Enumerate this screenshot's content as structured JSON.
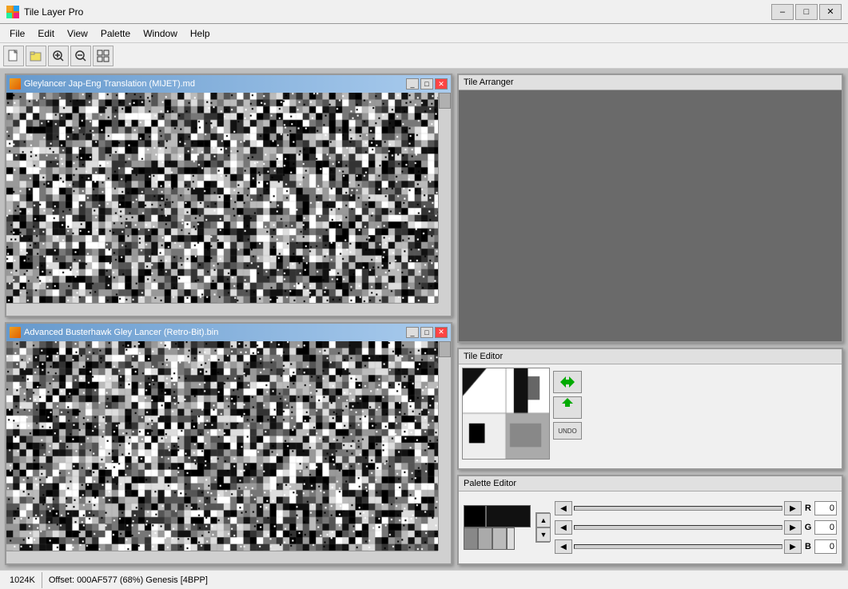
{
  "app": {
    "title": "Tile Layer Pro",
    "icon": "tile-icon"
  },
  "titlebar": {
    "minimize_label": "–",
    "maximize_label": "□",
    "close_label": "✕"
  },
  "menubar": {
    "items": [
      "File",
      "Edit",
      "View",
      "Palette",
      "Window",
      "Help"
    ]
  },
  "toolbar": {
    "buttons": [
      "new",
      "open",
      "zoom-in",
      "zoom-out",
      "grid"
    ]
  },
  "windows": {
    "tile_window_1": {
      "title": "Gleylancer Jap-Eng Translation (MIJET).md"
    },
    "tile_window_2": {
      "title": "Advanced Busterhawk Gley Lancer (Retro-Bit).bin"
    }
  },
  "panels": {
    "tile_arranger": {
      "title": "Tile Arranger"
    },
    "tile_editor": {
      "title": "Tile Editor",
      "undo_label": "UNDO",
      "flip_h_label": "↔",
      "flip_v_label": "↑"
    },
    "palette_editor": {
      "title": "Palette Editor",
      "r_label": "R",
      "g_label": "G",
      "b_label": "B",
      "r_value": "0",
      "g_value": "0",
      "b_value": "0"
    }
  },
  "statusbar": {
    "size": "1024K",
    "offset_info": "Offset: 000AF577 (68%) Genesis [4BPP]"
  }
}
